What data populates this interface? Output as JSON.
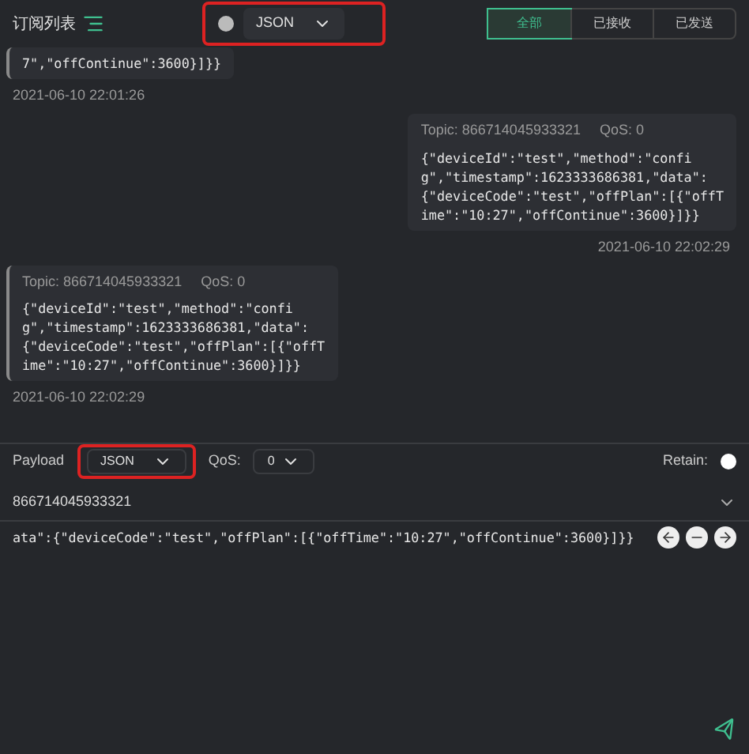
{
  "header": {
    "title": "订阅列表",
    "format_select": {
      "value": "JSON"
    },
    "filters": [
      {
        "label": "全部",
        "selected": true
      },
      {
        "label": "已接收",
        "selected": false
      },
      {
        "label": "已发送",
        "selected": false
      }
    ]
  },
  "messages": [
    {
      "kind": "received",
      "lines": [
        "7\",\"offContinue\":3600}]}}"
      ],
      "time": "2021-06-10 22:01:26"
    },
    {
      "kind": "sent",
      "topic": "Topic: 866714045933321",
      "qos": "QoS: 0",
      "lines": [
        "{\"deviceId\":\"test\",\"method\":\"confi",
        "g\",\"timestamp\":1623333686381,\"data\":",
        "{\"deviceCode\":\"test\",\"offPlan\":[{\"offT",
        "ime\":\"10:27\",\"offContinue\":3600}]}}"
      ],
      "time": "2021-06-10 22:02:29"
    },
    {
      "kind": "received",
      "topic": "Topic: 866714045933321",
      "qos": "QoS: 0",
      "lines": [
        "{\"deviceId\":\"test\",\"method\":\"confi",
        "g\",\"timestamp\":1623333686381,\"data\":",
        "{\"deviceCode\":\"test\",\"offPlan\":[{\"offT",
        "ime\":\"10:27\",\"offContinue\":3600}]}}"
      ],
      "time": "2021-06-10 22:02:29"
    }
  ],
  "publish": {
    "payload_label": "Payload",
    "payload_format": "JSON",
    "qos_label": "QoS:",
    "qos_value": "0",
    "retain_label": "Retain:",
    "retain": false,
    "topic": "866714045933321",
    "payload": "ata\":{\"deviceCode\":\"test\",\"offPlan\":[{\"offTime\":\"10:27\",\"offContinue\":3600}]}}"
  }
}
